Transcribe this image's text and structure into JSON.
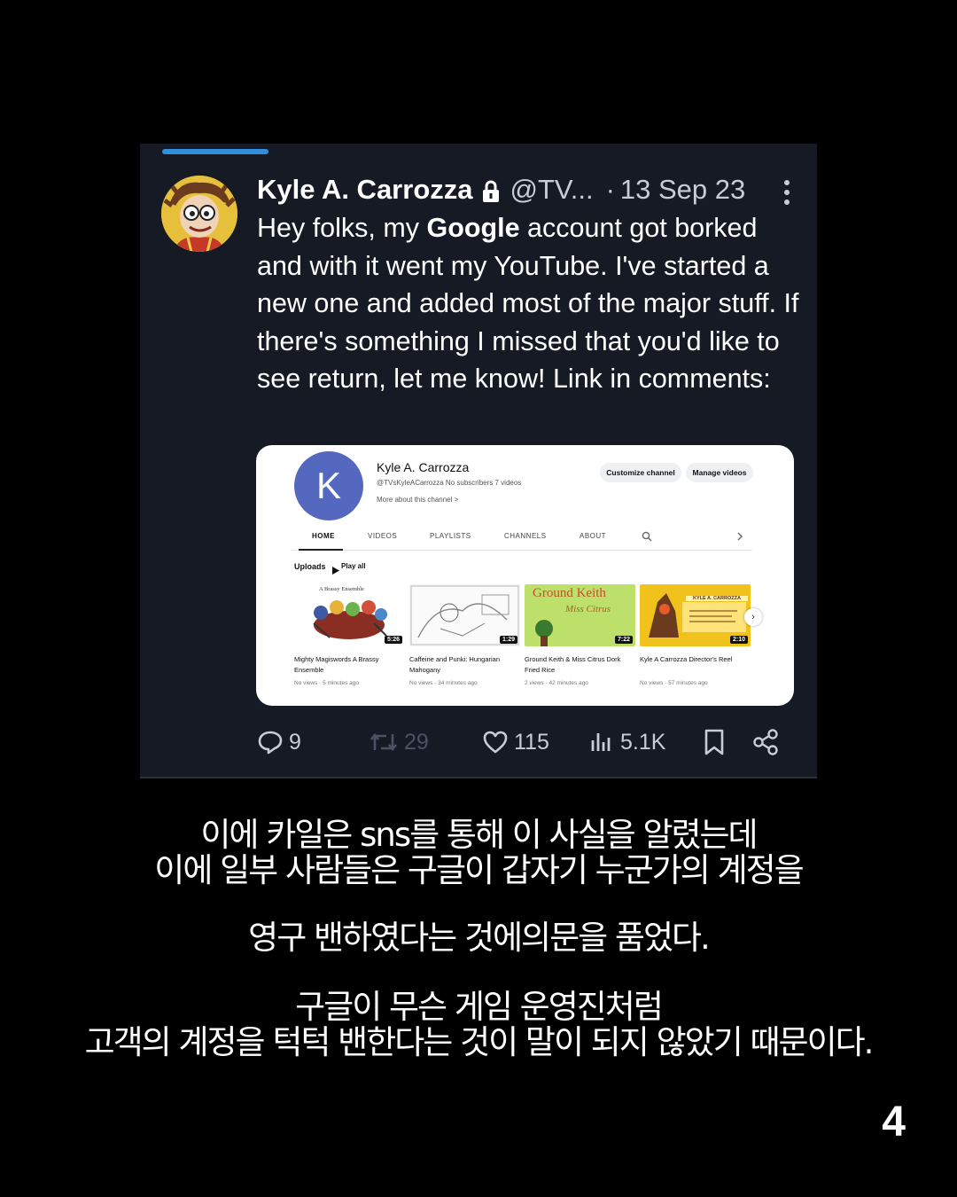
{
  "tweet": {
    "author_name": "Kyle A. Carrozza",
    "handle": "@TV...",
    "separator": "·",
    "date": "13 Sep 23",
    "text_parts": [
      "Hey folks, my ",
      "Google",
      " account got borked and with it went my YouTube. I've started a new one and added most of the major stuff. If there's something I missed that you'd like to see return, let me know! Link in comments:"
    ],
    "stats": {
      "replies": "9",
      "retweets": "29",
      "likes": "115",
      "views": "5.1K"
    }
  },
  "youtube": {
    "avatar_letter": "K",
    "channel_name": "Kyle A. Carrozza",
    "channel_meta": "@TVsKyleACarrozza   No subscribers   7 videos",
    "more_about": "More about this channel  >",
    "customize_button": "Customize channel",
    "manage_button": "Manage videos",
    "tabs": [
      "HOME",
      "VIDEOS",
      "PLAYLISTS",
      "CHANNELS",
      "ABOUT"
    ],
    "uploads_label": "Uploads",
    "play_all_label": "Play all",
    "videos": [
      {
        "title": "Mighty Magiswords A Brassy Ensemble",
        "meta": "No views · 5 minutes ago",
        "duration": "5:26",
        "thumb_caption": "A Brassy Ensemble"
      },
      {
        "title": "Caffeine and Punki: Hungarian Mahogany",
        "meta": "No views · 34 minutes ago",
        "duration": "1:29"
      },
      {
        "title": "Ground Keith & Miss Citrus Dork Fried Rice",
        "meta": "2 views · 42 minutes ago",
        "duration": "7:22",
        "thumb_title_1": "Ground Keith",
        "thumb_title_2": "Miss Citrus"
      },
      {
        "title": "Kyle A Carrozza Director's Reel",
        "meta": "No views · 57 minutes ago",
        "duration": "2:10",
        "thumb_caption": "KYLE A. CARROZZA"
      }
    ]
  },
  "caption": {
    "line1": "이에 카일은 sns를 통해 이 사실을 알렸는데",
    "line2": "이에 일부 사람들은 구글이 갑자기 누군가의 계정을",
    "line3": "영구 밴하였다는 것에의문을 품었다.",
    "line4": "구글이 무슨 게임 운영진처럼",
    "line5": "고객의 계정을 턱턱 밴한다는 것이 말이 되지 않았기 때문이다."
  },
  "page_number": "4",
  "colors": {
    "background": "#000000",
    "card": "#151a24",
    "accent_blue": "#2f8fdc",
    "yt_avatar": "#5468bf"
  }
}
